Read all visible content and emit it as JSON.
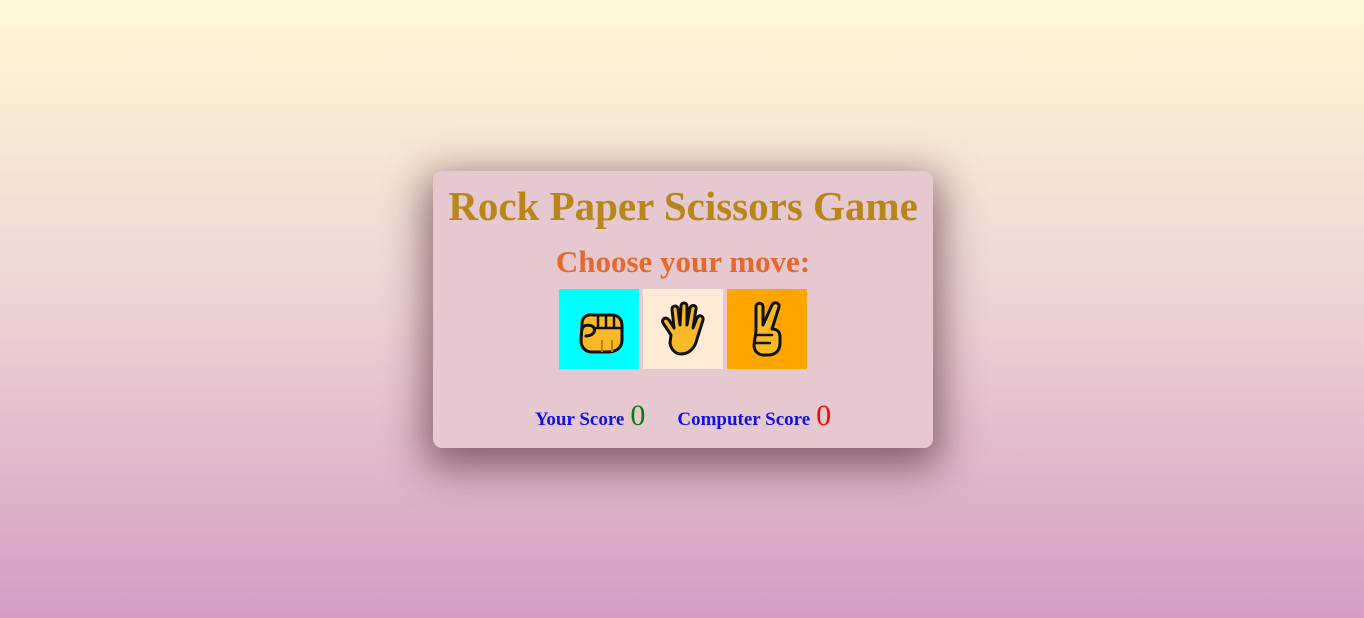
{
  "game": {
    "title": "Rock Paper Scissors Game",
    "prompt": "Choose your move:",
    "moves": [
      {
        "name": "rock",
        "icon": "fist-icon",
        "bg_color": "#00ffff"
      },
      {
        "name": "paper",
        "icon": "raised-hand-icon",
        "bg_color": "#ffebd6"
      },
      {
        "name": "scissors",
        "icon": "victory-hand-icon",
        "bg_color": "#ffa500"
      }
    ],
    "scores": {
      "user_label": "Your Score",
      "user_value": "0",
      "user_color": "#0a7a0a",
      "computer_label": "Computer Score",
      "computer_value": "0",
      "computer_color": "#ff0000"
    }
  }
}
